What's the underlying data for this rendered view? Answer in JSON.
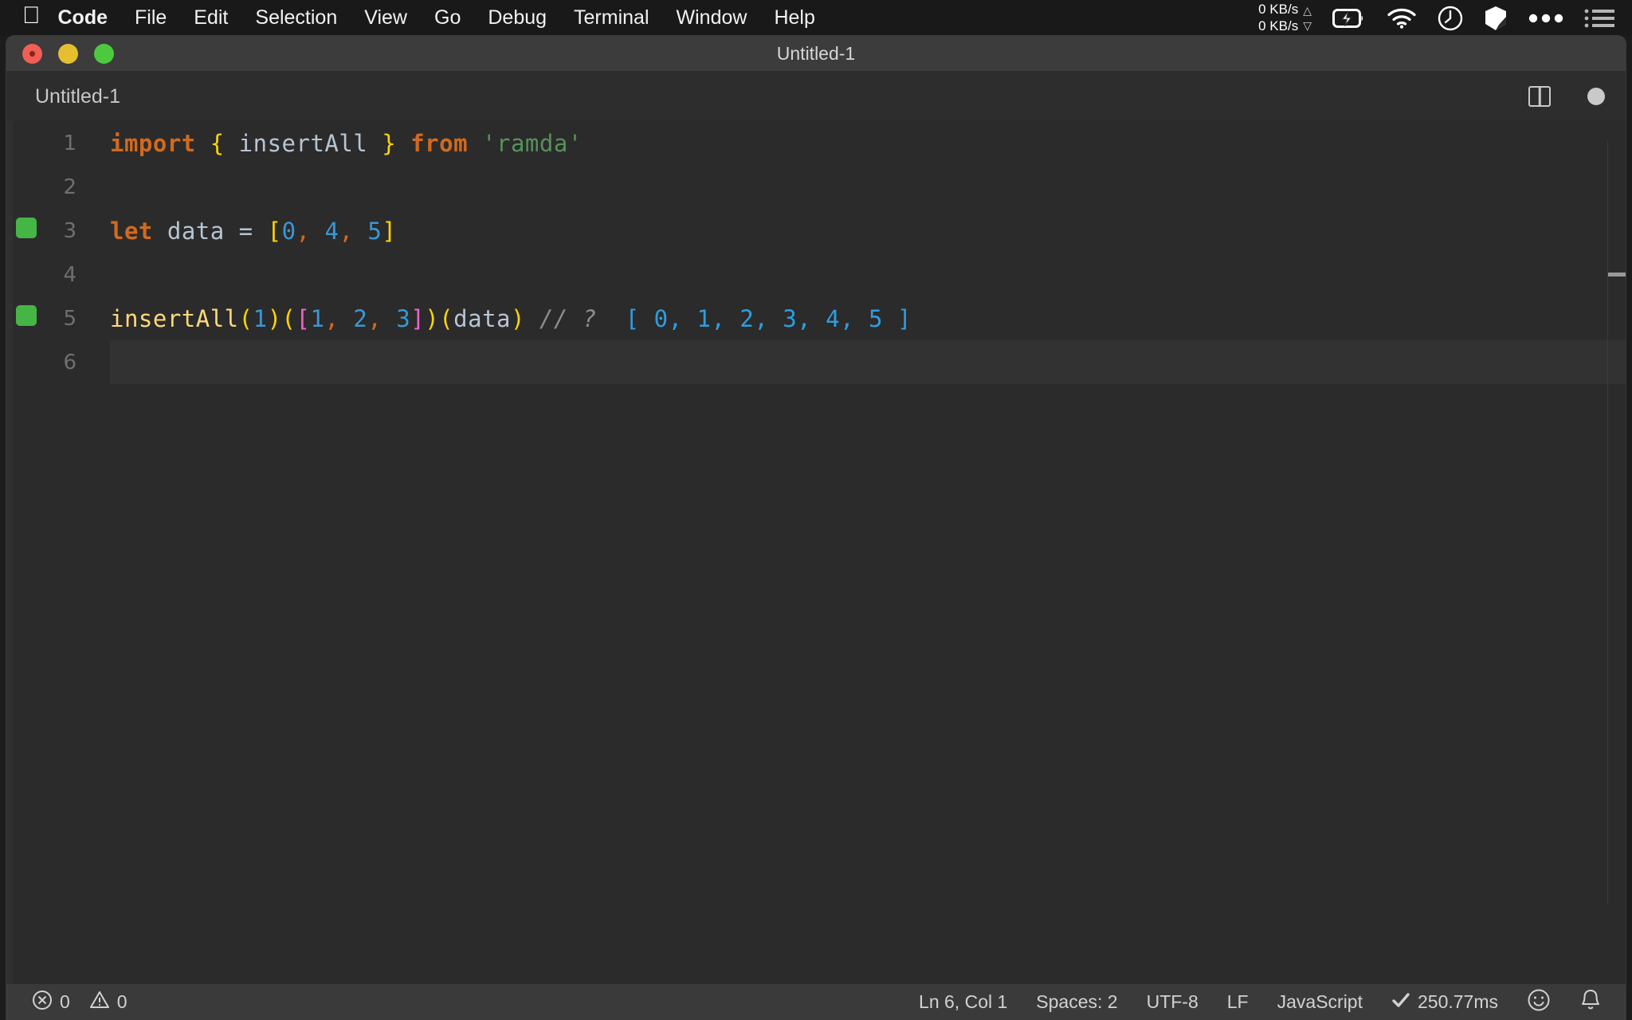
{
  "menubar": {
    "apple_icon": "apple-logo-icon",
    "items": [
      {
        "label": "Code",
        "bold": true
      },
      {
        "label": "File",
        "bold": false
      },
      {
        "label": "Edit",
        "bold": false
      },
      {
        "label": "Selection",
        "bold": false
      },
      {
        "label": "View",
        "bold": false
      },
      {
        "label": "Go",
        "bold": false
      },
      {
        "label": "Debug",
        "bold": false
      },
      {
        "label": "Terminal",
        "bold": false
      },
      {
        "label": "Window",
        "bold": false
      },
      {
        "label": "Help",
        "bold": false
      }
    ],
    "tray": {
      "net_up": "0 KB/s",
      "net_down": "0 KB/s",
      "battery_icon": "battery-charging-icon",
      "wifi_icon": "wifi-icon",
      "clock_icon": "clock-icon",
      "app_icon": "cube-icon",
      "more_icon": "ellipsis-icon",
      "list_icon": "list-icon"
    }
  },
  "window": {
    "title": "Untitled-1",
    "traffic_lights": [
      "close",
      "minimize",
      "zoom"
    ]
  },
  "tabbar": {
    "tabs": [
      {
        "label": "Untitled-1",
        "active": true
      }
    ],
    "split_editor_label": "split-editor",
    "dirty_indicator_label": "unsaved-changes"
  },
  "editor": {
    "lines": [
      {
        "number": "1",
        "marker": false,
        "active": false,
        "tokens": [
          {
            "t": "import",
            "c": "kw"
          },
          {
            "t": " ",
            "c": "op"
          },
          {
            "t": "{",
            "c": "brace"
          },
          {
            "t": " ",
            "c": "op"
          },
          {
            "t": "insertAll",
            "c": "ident"
          },
          {
            "t": " ",
            "c": "op"
          },
          {
            "t": "}",
            "c": "brace"
          },
          {
            "t": " ",
            "c": "op"
          },
          {
            "t": "from",
            "c": "kw"
          },
          {
            "t": " ",
            "c": "op"
          },
          {
            "t": "'ramda'",
            "c": "str"
          }
        ]
      },
      {
        "number": "2",
        "marker": false,
        "active": false,
        "tokens": []
      },
      {
        "number": "3",
        "marker": true,
        "active": false,
        "tokens": [
          {
            "t": "let",
            "c": "kw"
          },
          {
            "t": " ",
            "c": "op"
          },
          {
            "t": "data",
            "c": "ident"
          },
          {
            "t": " ",
            "c": "op"
          },
          {
            "t": "=",
            "c": "op"
          },
          {
            "t": " ",
            "c": "op"
          },
          {
            "t": "[",
            "c": "brace"
          },
          {
            "t": "0",
            "c": "num"
          },
          {
            "t": ",",
            "c": "punct"
          },
          {
            "t": " ",
            "c": "op"
          },
          {
            "t": "4",
            "c": "num"
          },
          {
            "t": ",",
            "c": "punct"
          },
          {
            "t": " ",
            "c": "op"
          },
          {
            "t": "5",
            "c": "num"
          },
          {
            "t": "]",
            "c": "brace"
          }
        ]
      },
      {
        "number": "4",
        "marker": false,
        "active": false,
        "tokens": []
      },
      {
        "number": "5",
        "marker": true,
        "active": false,
        "tokens": [
          {
            "t": "insertAll",
            "c": "fn"
          },
          {
            "t": "(",
            "c": "paren"
          },
          {
            "t": "1",
            "c": "num"
          },
          {
            "t": ")",
            "c": "paren"
          },
          {
            "t": "(",
            "c": "paren"
          },
          {
            "t": "[",
            "c": "sbrack"
          },
          {
            "t": "1",
            "c": "num"
          },
          {
            "t": ",",
            "c": "punct"
          },
          {
            "t": " ",
            "c": "op"
          },
          {
            "t": "2",
            "c": "num"
          },
          {
            "t": ",",
            "c": "punct"
          },
          {
            "t": " ",
            "c": "op"
          },
          {
            "t": "3",
            "c": "num"
          },
          {
            "t": "]",
            "c": "sbrack"
          },
          {
            "t": ")",
            "c": "paren"
          },
          {
            "t": "(",
            "c": "paren"
          },
          {
            "t": "data",
            "c": "ident"
          },
          {
            "t": ")",
            "c": "paren"
          },
          {
            "t": " ",
            "c": "op"
          },
          {
            "t": "// ?",
            "c": "cmt"
          },
          {
            "t": "  ",
            "c": "op"
          },
          {
            "t": "[ 0, 1, 2, 3, 4, 5 ]",
            "c": "res"
          }
        ]
      },
      {
        "number": "6",
        "marker": false,
        "active": true,
        "tokens": []
      }
    ]
  },
  "statusbar": {
    "errors": "0",
    "warnings": "0",
    "error_icon": "error-circle-icon",
    "warning_icon": "warning-triangle-icon",
    "cursor_position": "Ln 6, Col 1",
    "indentation": "Spaces: 2",
    "encoding": "UTF-8",
    "eol": "LF",
    "language": "JavaScript",
    "run_time": "250.77ms",
    "run_check_icon": "check-icon",
    "feedback_icon": "smiley-icon",
    "bell_icon": "bell-icon"
  },
  "colors": {
    "menubar_bg": "#191919",
    "titlebar_bg": "#3c3c3c",
    "tabbar_bg": "#2d2d2d",
    "editor_bg": "#2b2b2b",
    "statusbar_bg": "#3a3a3a",
    "keyword": "#d2691e",
    "string": "#57915a",
    "number": "#3a97d4",
    "brace": "#ffd500",
    "bracket": "#ef62c8",
    "function": "#ffd87a",
    "comment": "#8d8d8d",
    "result": "#2d9ee0",
    "marker_green": "#45b545"
  }
}
